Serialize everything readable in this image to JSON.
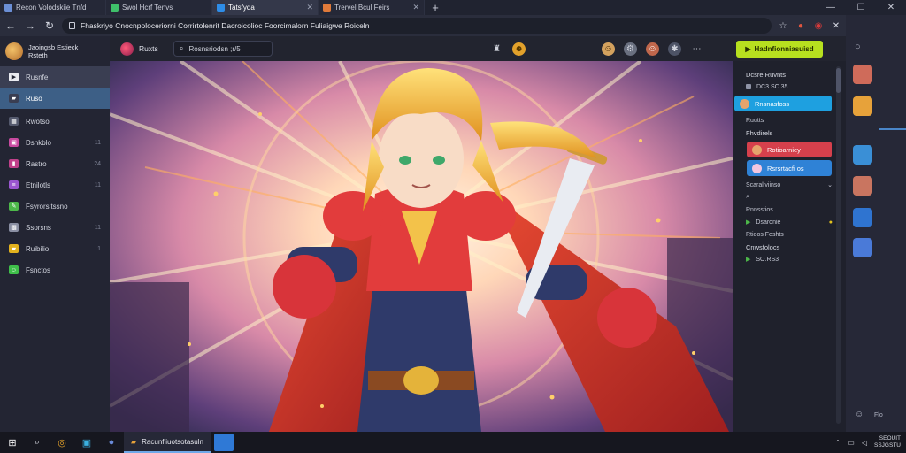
{
  "tabs": [
    {
      "label": "Recon Volodskiie Tnfd",
      "fav_color": "#6b8fd6"
    },
    {
      "label": "Swol Hcrf Tenvs",
      "fav_color": "#3fbf6a"
    },
    {
      "label": "Tatsfyda",
      "fav_color": "#2e8de8"
    },
    {
      "label": "Trervel Bcul Feirs",
      "fav_color": "#e07a3a"
    }
  ],
  "new_tab": "+",
  "window_controls": {
    "minimize": "—",
    "maximize": "☐",
    "close": "✕"
  },
  "address": {
    "url": "Fhaskriyo Cnocnpoloceriorni Corrirtolenrit Dacroicolioc Foorcimalorn Fuliaigwe Roiceln"
  },
  "profile": {
    "name": "Jaoingsb Estieck",
    "subtitle": "Rsteth"
  },
  "sidebar": {
    "items": [
      {
        "label": "Rusnfe",
        "count": "",
        "icon": "play-icon",
        "color": "#e9eaf0"
      },
      {
        "label": "Ruso",
        "count": "",
        "icon": "folder-icon",
        "color": "#3a3e52"
      },
      {
        "label": "Rwotso",
        "count": "",
        "icon": "grid-icon",
        "color": "#555a6e"
      },
      {
        "label": "Dsnkblo",
        "count": "11",
        "icon": "image-icon",
        "color": "#c84aa0"
      },
      {
        "label": "Rastro",
        "count": "24",
        "icon": "bookmark-icon",
        "color": "#c0408a"
      },
      {
        "label": "Etnilotls",
        "count": "11",
        "icon": "list-icon",
        "color": "#9a56d0"
      },
      {
        "label": "Fsyrorsitssno",
        "count": "",
        "icon": "pencil-icon",
        "color": "#4db84a"
      },
      {
        "label": "Ssorsns",
        "count": "11",
        "icon": "cube-icon",
        "color": "#8a8fa3"
      },
      {
        "label": "Ruibilio",
        "count": "1",
        "icon": "folder-icon",
        "color": "#e3b21e"
      },
      {
        "label": "Fsnctos",
        "count": "",
        "icon": "smile-icon",
        "color": "#3fbf4a"
      }
    ]
  },
  "toolbar": {
    "app_title": "Ruxts",
    "search_value": "Rosnsriodsn ;r/5",
    "action_label": "Hadnfionniasuisd"
  },
  "right_panel": {
    "section1_title": "Dcsre Ruvnts",
    "section1_row": "DC3 SC 35",
    "pill1_label": "Rnsnasfoss",
    "section2_sub": "Ruutts",
    "section2_title": "Fhvdirels",
    "pill2_label": "Rotioarniey",
    "pill3_label": "Rsrsrtacfi os",
    "row_a": "Scaraliviinso",
    "row_b": "Rnnsstios",
    "row_c": "Dsaronie",
    "row_d": "Rtioos Feshts",
    "section3_title": "Cnwsfolocs",
    "row_e": "SO.RS3"
  },
  "dock": {
    "label": "Flo",
    "colors": [
      "#cf6b5a",
      "#e7a23a",
      "#3a8fd6",
      "#c97560",
      "#2f74d0",
      "#4a7ad8"
    ]
  },
  "taskbar": {
    "app_label": "Racunfiiuotsotasuln",
    "clock_line1": "SEOUIT",
    "clock_line2": "SSJGSTU"
  },
  "colors": {
    "accent_green": "#b7e01f",
    "selected_blue": "#3d5f86",
    "pill_cyan": "#1ea0e0",
    "pill_red": "#d6404c",
    "pill_blue": "#2f82d6"
  }
}
